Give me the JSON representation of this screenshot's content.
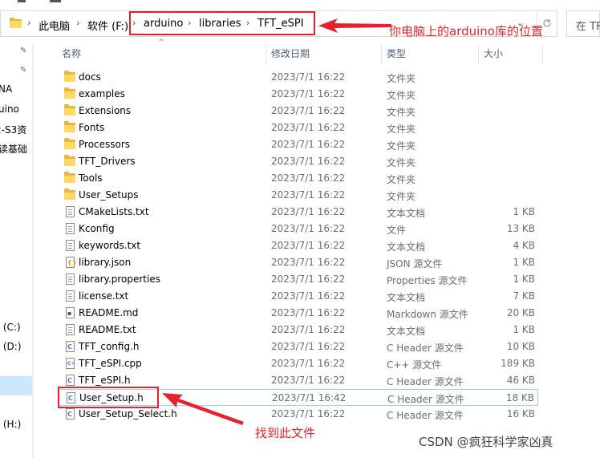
{
  "breadcrumb": [
    "此电脑",
    "软件 (F:)",
    "arduino",
    "libraries",
    "TFT_eSPI"
  ],
  "search_placeholder": "在 TF",
  "annotations": {
    "path_note": "你电脑上的arduino库的位置",
    "file_note": "找到此文件"
  },
  "nav": {
    "items": [
      "NA",
      "uino",
      "2-S3资",
      "读基础",
      ": (C:)",
      ": (D:)",
      ": (H:)"
    ]
  },
  "columns": {
    "name": "名称",
    "date": "修改日期",
    "type": "类型",
    "size": "大小"
  },
  "files": [
    {
      "name": "docs",
      "date": "2023/7/1 16:22",
      "type": "文件夹",
      "size": "",
      "icon": "folder-icon"
    },
    {
      "name": "examples",
      "date": "2023/7/1 16:22",
      "type": "文件夹",
      "size": "",
      "icon": "folder-icon"
    },
    {
      "name": "Extensions",
      "date": "2023/7/1 16:22",
      "type": "文件夹",
      "size": "",
      "icon": "folder-icon"
    },
    {
      "name": "Fonts",
      "date": "2023/7/1 16:22",
      "type": "文件夹",
      "size": "",
      "icon": "folder-icon"
    },
    {
      "name": "Processors",
      "date": "2023/7/1 16:22",
      "type": "文件夹",
      "size": "",
      "icon": "folder-icon"
    },
    {
      "name": "TFT_Drivers",
      "date": "2023/7/1 16:22",
      "type": "文件夹",
      "size": "",
      "icon": "folder-icon"
    },
    {
      "name": "Tools",
      "date": "2023/7/1 16:22",
      "type": "文件夹",
      "size": "",
      "icon": "folder-icon"
    },
    {
      "name": "User_Setups",
      "date": "2023/7/1 16:22",
      "type": "文件夹",
      "size": "",
      "icon": "folder-icon"
    },
    {
      "name": "CMakeLists.txt",
      "date": "2023/7/1 16:22",
      "type": "文本文档",
      "size": "1 KB",
      "icon": "text-file-icon"
    },
    {
      "name": "Kconfig",
      "date": "2023/7/1 16:22",
      "type": "文件",
      "size": "13 KB",
      "icon": "file-icon"
    },
    {
      "name": "keywords.txt",
      "date": "2023/7/1 16:22",
      "type": "文本文档",
      "size": "4 KB",
      "icon": "text-file-icon"
    },
    {
      "name": "library.json",
      "date": "2023/7/1 16:22",
      "type": "JSON 源文件",
      "size": "1 KB",
      "icon": "json-file-icon"
    },
    {
      "name": "library.properties",
      "date": "2023/7/1 16:22",
      "type": "Properties 源文件",
      "size": "1 KB",
      "icon": "file-icon"
    },
    {
      "name": "license.txt",
      "date": "2023/7/1 16:22",
      "type": "文本文档",
      "size": "7 KB",
      "icon": "text-file-icon"
    },
    {
      "name": "README.md",
      "date": "2023/7/1 16:22",
      "type": "Markdown 源文件",
      "size": "20 KB",
      "icon": "markdown-file-icon"
    },
    {
      "name": "README.txt",
      "date": "2023/7/1 16:22",
      "type": "文本文档",
      "size": "1 KB",
      "icon": "text-file-icon"
    },
    {
      "name": "TFT_config.h",
      "date": "2023/7/1 16:22",
      "type": "C Header 源文件",
      "size": "10 KB",
      "icon": "c-header-file-icon"
    },
    {
      "name": "TFT_eSPI.cpp",
      "date": "2023/7/1 16:22",
      "type": "C++ 源文件",
      "size": "189 KB",
      "icon": "cpp-file-icon"
    },
    {
      "name": "TFT_eSPI.h",
      "date": "2023/7/1 16:22",
      "type": "C Header 源文件",
      "size": "46 KB",
      "icon": "c-header-file-icon"
    },
    {
      "name": "User_Setup.h",
      "date": "2023/7/1 16:42",
      "type": "C Header 源文件",
      "size": "18 KB",
      "icon": "c-header-file-icon",
      "selected": true
    },
    {
      "name": "User_Setup_Select.h",
      "date": "2023/7/1 16:22",
      "type": "C Header 源文件",
      "size": "16 KB",
      "icon": "c-header-file-icon"
    }
  ],
  "watermark": "CSDN @疯狂科学家凶真",
  "colors": {
    "accent_red": "#e8222c",
    "folder": "#ffd866",
    "selection": "#99d1ff"
  }
}
